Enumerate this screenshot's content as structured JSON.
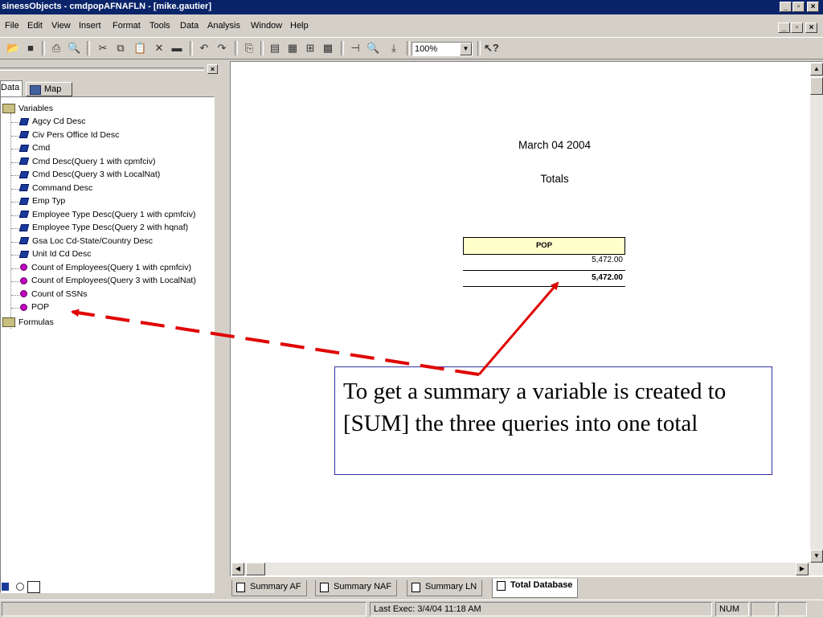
{
  "window": {
    "title": "sinessObjects - cmdpopAFNAFLN - [mike.gautier]"
  },
  "menu": [
    {
      "label": "File",
      "u": "F",
      "rest": "ile"
    },
    {
      "label": "Edit",
      "u": "E",
      "rest": "dit"
    },
    {
      "label": "View",
      "u": "V",
      "rest": "iew"
    },
    {
      "label": "Insert",
      "u": "I",
      "rest": "nsert"
    },
    {
      "label": "Format",
      "u": "o",
      "rest": ""
    },
    {
      "label": "Tools",
      "u": "T",
      "rest": "ools"
    },
    {
      "label": "Data",
      "u": "D",
      "rest": "ata"
    },
    {
      "label": "Analysis",
      "u": "y",
      "rest": ""
    },
    {
      "label": "Window",
      "u": "W",
      "rest": "indow"
    },
    {
      "label": "Help",
      "u": "H",
      "rest": "elp"
    }
  ],
  "toolbar": {
    "zoom": "100%"
  },
  "panel": {
    "tabs": [
      "Data",
      "Map"
    ],
    "variables_label": "Variables",
    "formulas_label": "Formulas",
    "items": [
      {
        "label": "Agcy Cd Desc",
        "kind": "dimension"
      },
      {
        "label": "Civ Pers Office Id Desc",
        "kind": "dimension"
      },
      {
        "label": "Cmd",
        "kind": "dimension"
      },
      {
        "label": "Cmd Desc(Query 1 with cpmfciv)",
        "kind": "dimension"
      },
      {
        "label": "Cmd Desc(Query 3 with LocalNat)",
        "kind": "dimension"
      },
      {
        "label": "Command Desc",
        "kind": "dimension"
      },
      {
        "label": "Emp Typ",
        "kind": "dimension"
      },
      {
        "label": "Employee Type Desc(Query 1 with cpmfciv)",
        "kind": "dimension"
      },
      {
        "label": "Employee Type Desc(Query 2 with hqnaf)",
        "kind": "dimension"
      },
      {
        "label": "Gsa Loc Cd-State/Country Desc",
        "kind": "dimension"
      },
      {
        "label": "Unit Id Cd Desc",
        "kind": "dimension"
      },
      {
        "label": "Count of Employees(Query 1 with cpmfciv)",
        "kind": "measure"
      },
      {
        "label": "Count of Employees(Query 3 with LocalNat)",
        "kind": "measure"
      },
      {
        "label": "Count of SSNs",
        "kind": "measure"
      },
      {
        "label": "POP",
        "kind": "measure"
      }
    ]
  },
  "report": {
    "title": "March 04  2004",
    "subtitle": "Totals",
    "table": {
      "header": "POP",
      "value": "5,472.00",
      "total": "5,472.00"
    }
  },
  "callout": {
    "text": "To get a summary a variable is created to [SUM] the three queries into one total"
  },
  "sheets": [
    {
      "label": "Summary AF",
      "active": false
    },
    {
      "label": "Summary NAF",
      "active": false
    },
    {
      "label": "Summary LN",
      "active": false
    },
    {
      "label": "Total Database",
      "active": true
    }
  ],
  "status": {
    "last_exec": "Last Exec: 3/4/04  11:18 AM",
    "num": "NUM"
  },
  "colors": {
    "titlebar": "#0a246a",
    "table_header_bg": "#ffffcc",
    "arrow": "#e00000",
    "measure_dot": "#c000c0"
  }
}
